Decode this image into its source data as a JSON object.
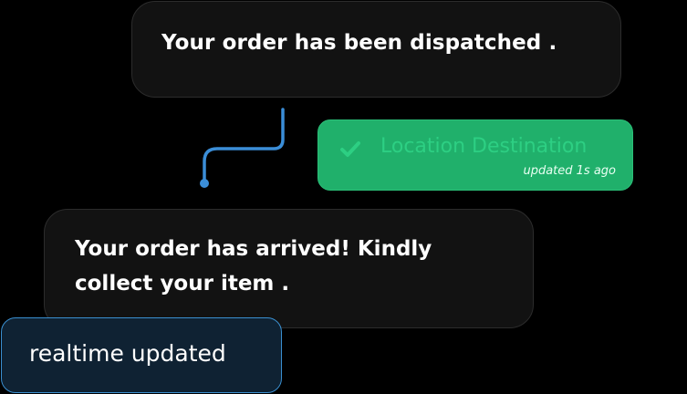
{
  "messages": {
    "dispatched": "Your order has been dispatched .",
    "arrived": "Your order has arrived! Kindly collect your item ."
  },
  "location_badge": {
    "label": "Location Destination",
    "updated": "updated 1s ago",
    "icon": "check-icon",
    "color": "#20b06b"
  },
  "realtime_badge": {
    "label": "realtime updated",
    "color": "#0f2233",
    "border": "#3a8fd0"
  },
  "connector": {
    "icon": "arrow-connector",
    "color": "#3b8ed8"
  }
}
